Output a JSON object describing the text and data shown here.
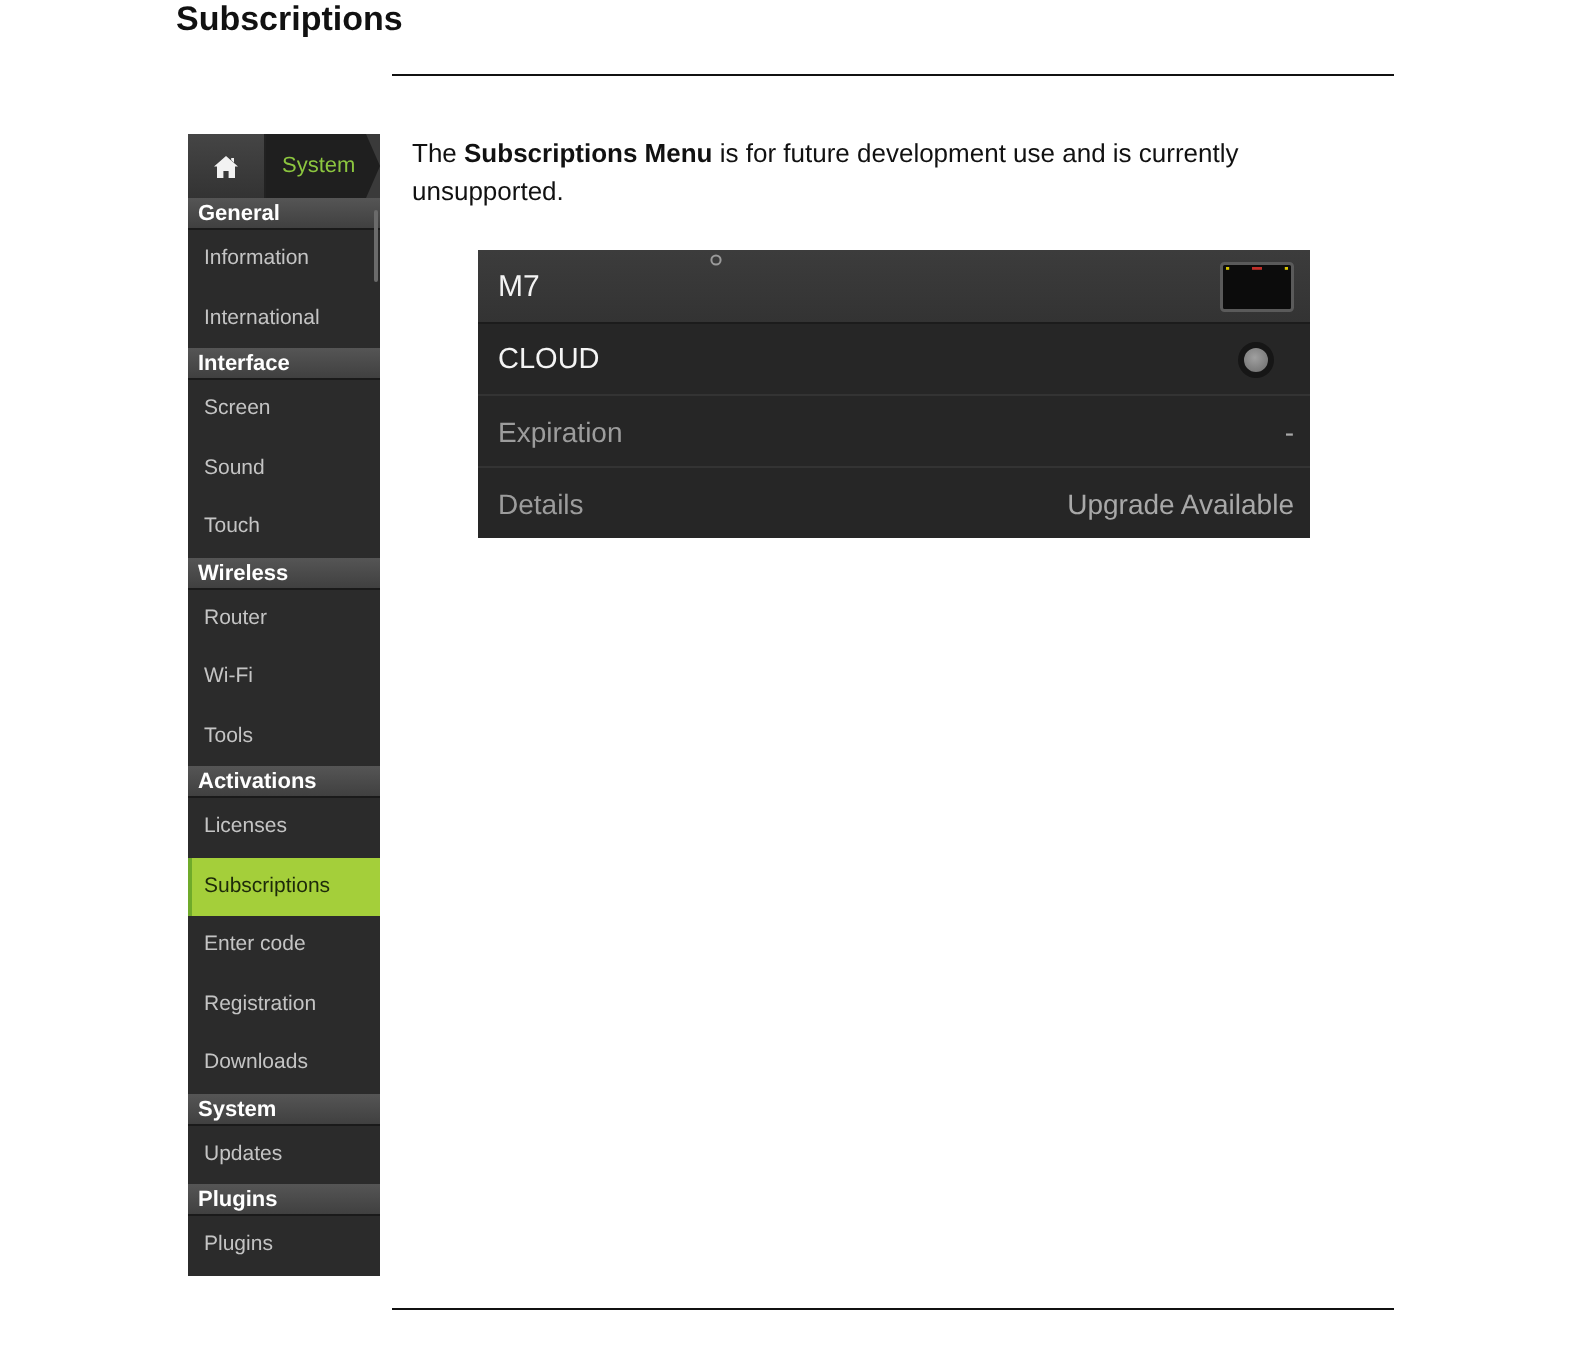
{
  "heading": "Subscriptions",
  "sidebar": {
    "breadcrumb": "System",
    "sections": [
      {
        "title": "General",
        "items": [
          {
            "label": "Information",
            "selected": false
          },
          {
            "label": "International",
            "selected": false
          }
        ]
      },
      {
        "title": "Interface",
        "items": [
          {
            "label": "Screen",
            "selected": false
          },
          {
            "label": "Sound",
            "selected": false
          },
          {
            "label": "Touch",
            "selected": false
          }
        ]
      },
      {
        "title": "Wireless",
        "items": [
          {
            "label": "Router",
            "selected": false
          },
          {
            "label": "Wi-Fi",
            "selected": false
          },
          {
            "label": "Tools",
            "selected": false
          }
        ]
      },
      {
        "title": "Activations",
        "items": [
          {
            "label": "Licenses",
            "selected": false
          },
          {
            "label": "Subscriptions",
            "selected": true
          },
          {
            "label": "Enter code",
            "selected": false
          },
          {
            "label": "Registration",
            "selected": false
          },
          {
            "label": "Downloads",
            "selected": false
          }
        ]
      },
      {
        "title": "System",
        "items": [
          {
            "label": "Updates",
            "selected": false
          }
        ]
      },
      {
        "title": "Plugins",
        "items": [
          {
            "label": "Plugins",
            "selected": false
          }
        ]
      }
    ]
  },
  "description": "The **Subscriptions Menu** is for future development use and is currently unsupported.",
  "panel": {
    "title": "M7",
    "rows": [
      {
        "kind": "toggle",
        "label": "CLOUD",
        "on": false
      },
      {
        "kind": "value",
        "label": "Expiration",
        "value": "-"
      },
      {
        "kind": "value",
        "label": "Details",
        "value": "Upgrade Available"
      }
    ]
  }
}
